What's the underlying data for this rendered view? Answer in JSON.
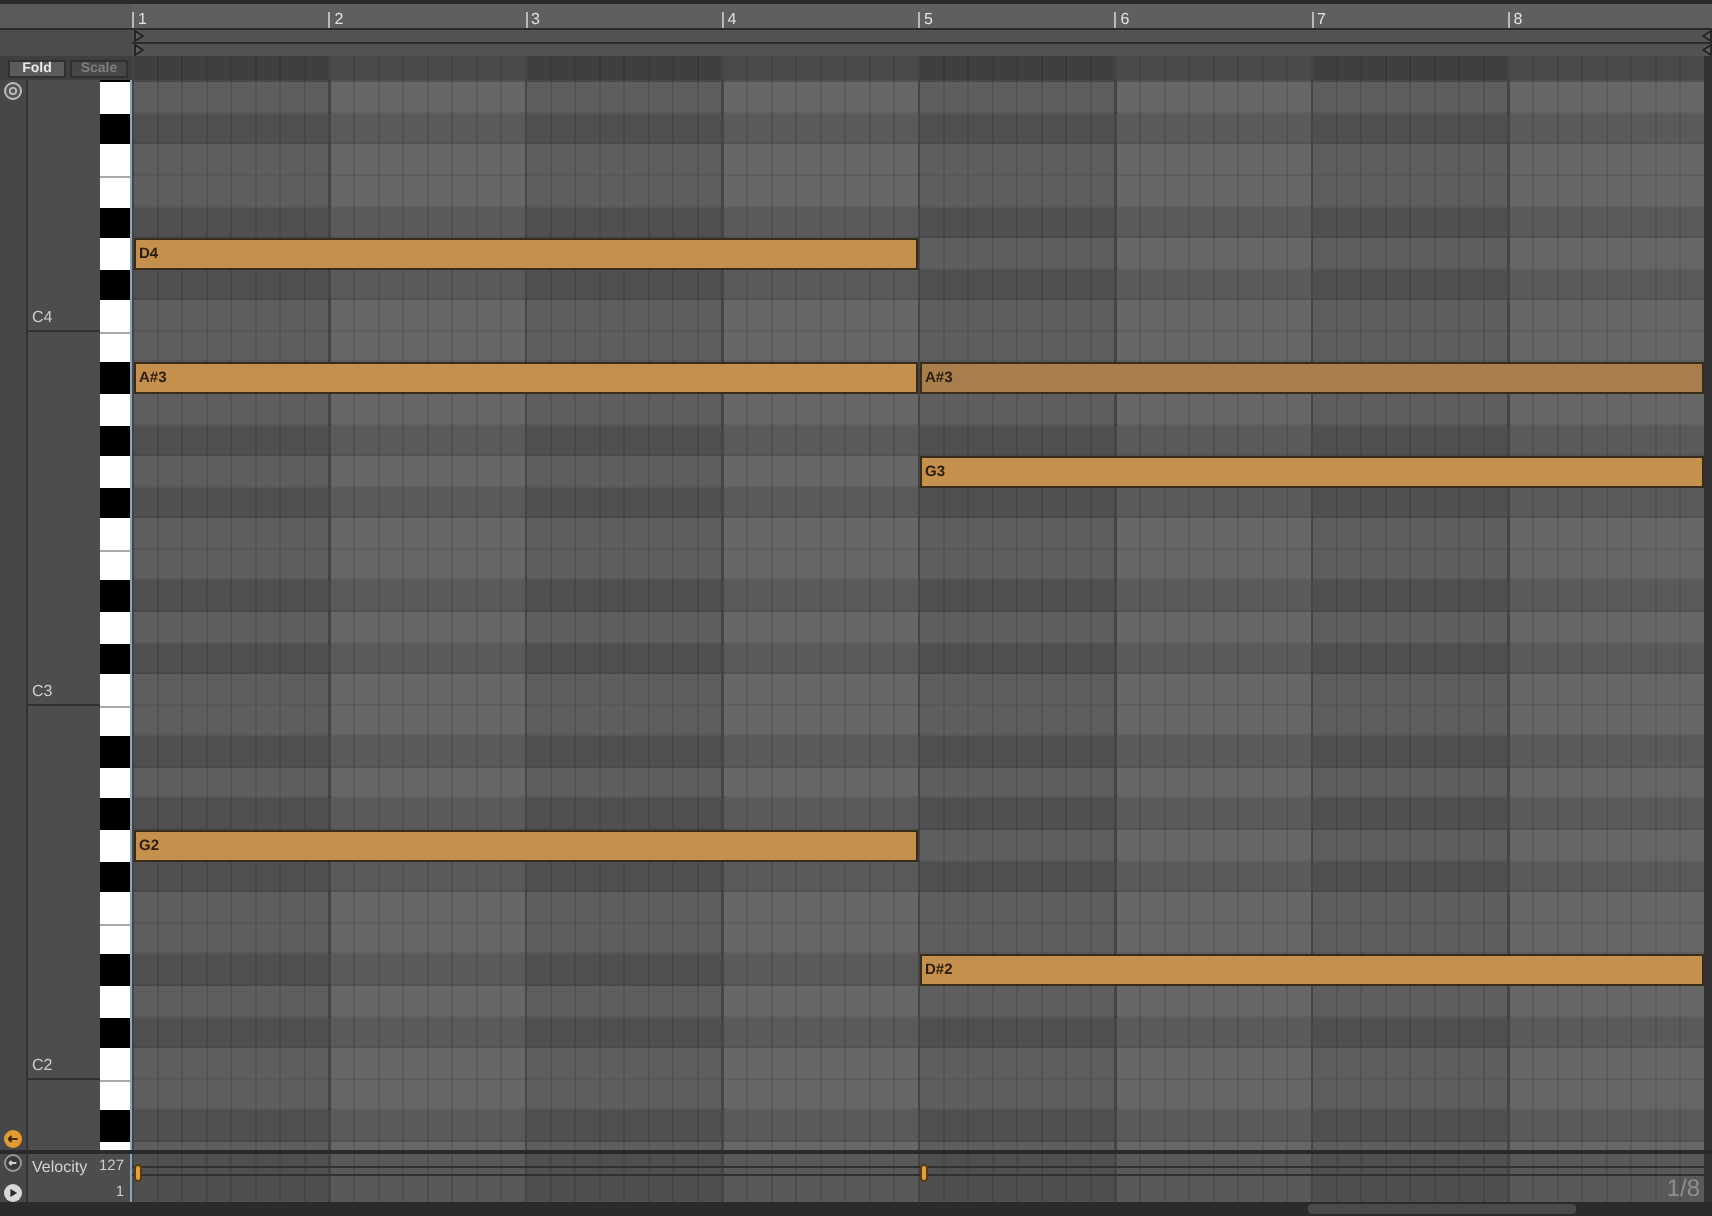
{
  "ruler": {
    "bars": [
      "1",
      "2",
      "3",
      "4",
      "5",
      "6",
      "7",
      "8"
    ]
  },
  "buttons": [
    {
      "label": "Fold",
      "disabled": false
    },
    {
      "label": "Scale",
      "disabled": true
    }
  ],
  "piano_rows": [
    {
      "kind": "black"
    },
    {
      "kind": "white"
    },
    {
      "kind": "black"
    },
    {
      "kind": "white"
    },
    {
      "kind": "white"
    },
    {
      "kind": "black"
    },
    {
      "kind": "white",
      "notes": [
        {
          "label": "D4",
          "second_half": false,
          "color": "#c4904b"
        }
      ]
    },
    {
      "kind": "black"
    },
    {
      "kind": "white",
      "label": "C4"
    },
    {
      "kind": "white"
    },
    {
      "kind": "black",
      "notes": [
        {
          "label": "A#3",
          "second_half": false,
          "color": "#c4904b"
        },
        {
          "label": "A#3",
          "second_half": true,
          "color": "#a87e4d"
        }
      ]
    },
    {
      "kind": "white"
    },
    {
      "kind": "black"
    },
    {
      "kind": "white",
      "notes": [
        {
          "label": "G3",
          "second_half": true,
          "color": "#c4904b"
        }
      ]
    },
    {
      "kind": "black"
    },
    {
      "kind": "white"
    },
    {
      "kind": "white"
    },
    {
      "kind": "black"
    },
    {
      "kind": "white"
    },
    {
      "kind": "black"
    },
    {
      "kind": "white",
      "label": "C3"
    },
    {
      "kind": "white"
    },
    {
      "kind": "black"
    },
    {
      "kind": "white"
    },
    {
      "kind": "black"
    },
    {
      "kind": "white",
      "notes": [
        {
          "label": "G2",
          "second_half": false,
          "color": "#c4904b"
        }
      ]
    },
    {
      "kind": "black"
    },
    {
      "kind": "white"
    },
    {
      "kind": "white"
    },
    {
      "kind": "black",
      "notes": [
        {
          "label": "D#2",
          "second_half": true,
          "color": "#c4904b"
        }
      ]
    },
    {
      "kind": "white"
    },
    {
      "kind": "black"
    },
    {
      "kind": "white",
      "label": "C2"
    },
    {
      "kind": "white"
    },
    {
      "kind": "black"
    },
    {
      "kind": "white"
    }
  ],
  "velocity_lane": {
    "title": "Velocity",
    "max": "127",
    "min": "1"
  },
  "grid_size": "1/8"
}
